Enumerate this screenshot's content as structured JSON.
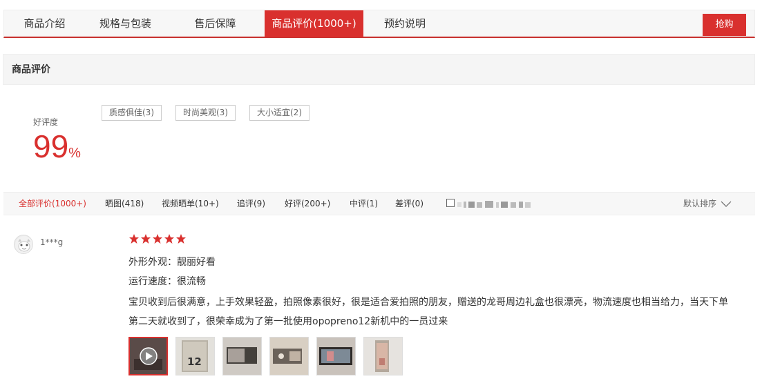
{
  "tabs": [
    {
      "label": "商品介绍",
      "active": false
    },
    {
      "label": "规格与包装",
      "active": false
    },
    {
      "label": "售后保障",
      "active": false
    },
    {
      "label": "商品评价(1000+)",
      "active": true
    },
    {
      "label": "预约说明",
      "active": false
    }
  ],
  "buy_button": "抢购",
  "section_title": "商品评价",
  "rating": {
    "label": "好评度",
    "value": "99",
    "unit": "%"
  },
  "tags": [
    "质感俱佳(3)",
    "时尚美观(3)",
    "大小适宜(2)"
  ],
  "filters": [
    {
      "label": "全部评价(1000+)",
      "active": true
    },
    {
      "label": "晒图(418)",
      "active": false
    },
    {
      "label": "视频晒单(10+)",
      "active": false
    },
    {
      "label": "追评(9)",
      "active": false
    },
    {
      "label": "好评(200+)",
      "active": false
    },
    {
      "label": "中评(1)",
      "active": false
    },
    {
      "label": "差评(0)",
      "active": false
    }
  ],
  "sort_label": "默认排序",
  "review": {
    "username": "1***g",
    "stars": 5,
    "appearance": "外形外观：靓丽好看",
    "speed": "运行速度：很流畅",
    "content": "宝贝收到后很满意，上手效果轻盈，拍照像素很好，很是适合爱拍照的朋友，赠送的龙哥周边礼盒也很漂亮，物流速度也相当给力，当天下单第二天就收到了，很荣幸成为了第一批使用opopreno12新机中的一员过来",
    "thumbnail_label": "12"
  },
  "colors": {
    "accent": "#d9302e"
  }
}
